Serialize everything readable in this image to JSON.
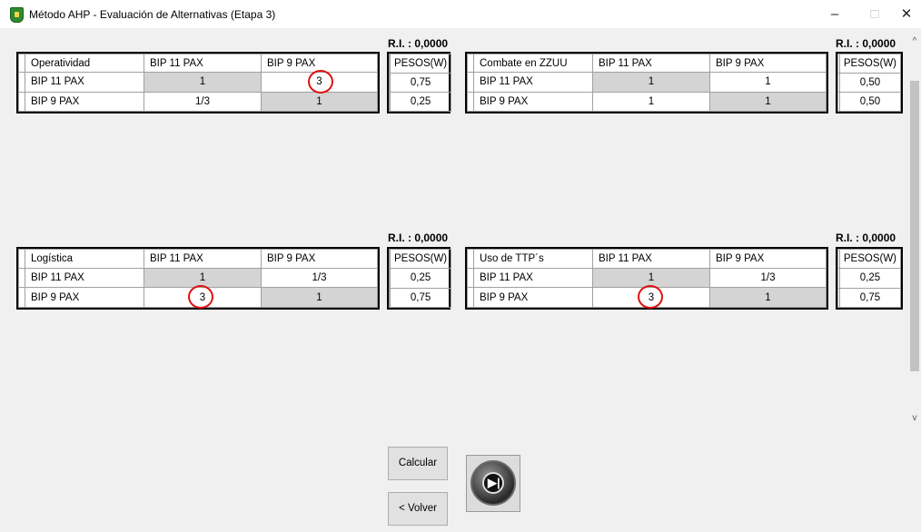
{
  "window": {
    "title": "Método AHP - Evaluación de Alternativas (Etapa 3)",
    "controls": {
      "minimize": "–",
      "maximize": "□",
      "close": "✕"
    }
  },
  "panels": [
    {
      "name": "operatividad",
      "ri": "R.I. : 0,0000",
      "header": [
        "Operatividad",
        "BIP 11 PAX",
        "BIP 9 PAX"
      ],
      "rows": [
        {
          "label": "BIP 11 PAX",
          "c1": "1",
          "c2": "3"
        },
        {
          "label": "BIP 9 PAX",
          "c1": "1/3",
          "c2": "1"
        }
      ],
      "weights_header": "PESOS(W)",
      "weights": [
        "0,75",
        "0,25"
      ]
    },
    {
      "name": "combate",
      "ri": "R.I. : 0,0000",
      "header": [
        "Combate en ZZUU",
        "BIP 11 PAX",
        "BIP 9 PAX"
      ],
      "rows": [
        {
          "label": "BIP 11 PAX",
          "c1": "1",
          "c2": "1"
        },
        {
          "label": "BIP 9 PAX",
          "c1": "1",
          "c2": "1"
        }
      ],
      "weights_header": "PESOS(W)",
      "weights": [
        "0,50",
        "0,50"
      ]
    },
    {
      "name": "logistica",
      "ri": "R.I. : 0,0000",
      "header": [
        "Logística",
        "BIP 11 PAX",
        "BIP 9 PAX"
      ],
      "rows": [
        {
          "label": "BIP 11 PAX",
          "c1": "1",
          "c2": "1/3"
        },
        {
          "label": "BIP 9 PAX",
          "c1": "3",
          "c2": "1"
        }
      ],
      "weights_header": "PESOS(W)",
      "weights": [
        "0,25",
        "0,75"
      ]
    },
    {
      "name": "uso-ttp",
      "ri": "R.I. : 0,0000",
      "header": [
        "Uso de TTP´s",
        "BIP 11 PAX",
        "BIP 9 PAX"
      ],
      "rows": [
        {
          "label": "BIP 11 PAX",
          "c1": "1",
          "c2": "1/3"
        },
        {
          "label": "BIP 9 PAX",
          "c1": "3",
          "c2": "1"
        }
      ],
      "weights_header": "PESOS(W)",
      "weights": [
        "0,25",
        "0,75"
      ]
    }
  ],
  "buttons": {
    "calcular": "Calcular",
    "volver": "< Volver",
    "next_icon": "skip-next-icon"
  },
  "scrollbar": {
    "up": "^",
    "down": "v"
  },
  "colors": {
    "highlight_circle": "#e01010",
    "diagonal_cell": "#d4d4d4"
  }
}
